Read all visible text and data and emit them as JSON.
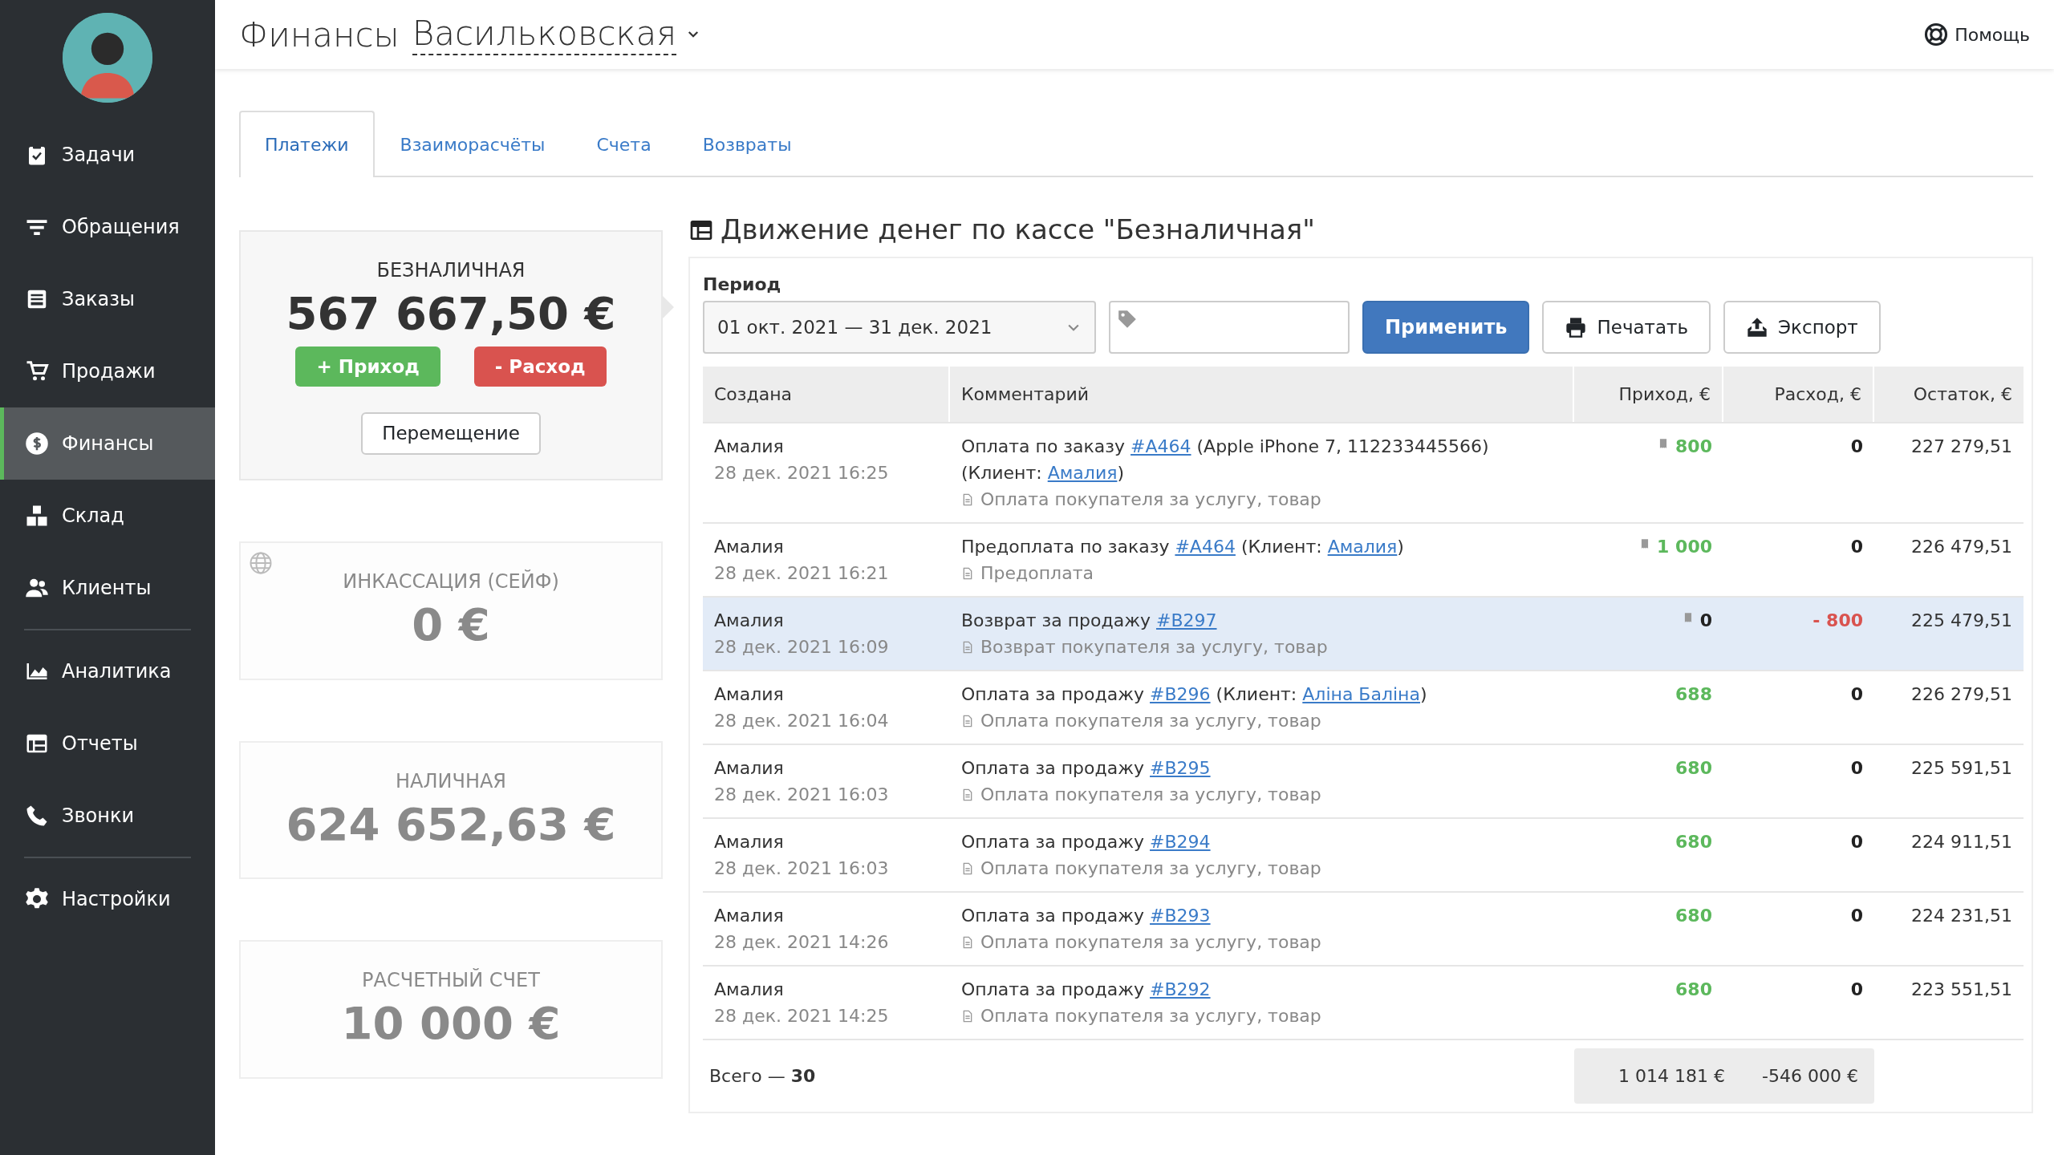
{
  "header": {
    "title": "Финансы",
    "store": "Васильковская",
    "help": "Помощь"
  },
  "sidebar": {
    "groups": [
      [
        {
          "label": "Задачи",
          "selected": false
        },
        {
          "label": "Обращения",
          "selected": false
        },
        {
          "label": "Заказы",
          "selected": false
        },
        {
          "label": "Продажи",
          "selected": false
        },
        {
          "label": "Финансы",
          "selected": true
        },
        {
          "label": "Склад",
          "selected": false
        },
        {
          "label": "Клиенты",
          "selected": false
        }
      ],
      [
        {
          "label": "Аналитика",
          "selected": false
        },
        {
          "label": "Отчеты",
          "selected": false
        },
        {
          "label": "Звонки",
          "selected": false
        }
      ],
      [
        {
          "label": "Настройки",
          "selected": false
        }
      ]
    ]
  },
  "tabs": [
    {
      "label": "Платежи",
      "selected": true
    },
    {
      "label": "Взаиморасчёты",
      "selected": false
    },
    {
      "label": "Счета",
      "selected": false
    },
    {
      "label": "Возвраты",
      "selected": false
    }
  ],
  "registers": [
    {
      "name": "БЕЗНАЛИЧНАЯ",
      "amount": "567 667,50 €",
      "selected": true,
      "kind": "plain",
      "buttons": [
        {
          "label": "+ Приход",
          "kind": "income"
        },
        {
          "label": "- Расход",
          "kind": "expense"
        },
        {
          "label": "Перемещение",
          "kind": "transfer"
        }
      ]
    },
    {
      "name": "ИНКАССАЦИЯ (СЕЙФ)",
      "amount": "0 €",
      "selected": false,
      "kind": "web"
    },
    {
      "name": "НАЛИЧНАЯ",
      "amount": "624 652,63 €",
      "selected": false,
      "kind": "plain"
    },
    {
      "name": "РАСЧЕТНЫЙ СЧЕТ",
      "amount": "10 000 €",
      "selected": false,
      "kind": "plain"
    }
  ],
  "movement": {
    "title": "Движение денег по кассе \"Безналичная\"",
    "period_label": "Период",
    "period": "01 окт. 2021 — 31 дек. 2021",
    "apply": "Применить",
    "print": "Печатать",
    "export": "Экспорт",
    "columns": [
      "Создана",
      "Комментарий",
      "Приход, €",
      "Расход, €",
      "Остаток, €"
    ],
    "rows": [
      {
        "author": "Амалия",
        "date": "28 дек. 2021 16:25",
        "comment": [
          {
            "kind": "text",
            "text": "Оплата по заказу "
          },
          {
            "kind": "link",
            "text": "#A464"
          },
          {
            "kind": "text",
            "text": " (Apple iPhone 7, 112233445566) (Клиент: "
          },
          {
            "kind": "link",
            "text": "Амалия"
          },
          {
            "kind": "text",
            "text": ")"
          }
        ],
        "note": "Оплата покупателя за услугу, товар",
        "receipt": true,
        "income": "800",
        "income_positive": true,
        "expense": "0",
        "expense_negative": false,
        "balance": "227 279,51",
        "selected": false
      },
      {
        "author": "Амалия",
        "date": "28 дек. 2021 16:21",
        "comment": [
          {
            "kind": "text",
            "text": "Предоплата по заказу "
          },
          {
            "kind": "link",
            "text": "#A464"
          },
          {
            "kind": "text",
            "text": " (Клиент: "
          },
          {
            "kind": "link",
            "text": "Амалия"
          },
          {
            "kind": "text",
            "text": ")"
          }
        ],
        "note": "Предоплата",
        "receipt": true,
        "income": "1 000",
        "income_positive": true,
        "expense": "0",
        "expense_negative": false,
        "balance": "226 479,51",
        "selected": false
      },
      {
        "author": "Амалия",
        "date": "28 дек. 2021 16:09",
        "comment": [
          {
            "kind": "text",
            "text": "Возврат за продажу "
          },
          {
            "kind": "link",
            "text": "#B297"
          }
        ],
        "note": "Возврат покупателя за услугу, товар",
        "receipt": true,
        "income": "0",
        "income_positive": false,
        "expense": "- 800",
        "expense_negative": true,
        "balance": "225 479,51",
        "selected": true
      },
      {
        "author": "Амалия",
        "date": "28 дек. 2021 16:04",
        "comment": [
          {
            "kind": "text",
            "text": "Оплата за продажу "
          },
          {
            "kind": "link",
            "text": "#B296"
          },
          {
            "kind": "text",
            "text": " (Клиент: "
          },
          {
            "kind": "link",
            "text": "Аліна Баліна"
          },
          {
            "kind": "text",
            "text": ")"
          }
        ],
        "note": "Оплата покупателя за услугу, товар",
        "receipt": false,
        "income": "688",
        "income_positive": true,
        "expense": "0",
        "expense_negative": false,
        "balance": "226 279,51",
        "selected": false
      },
      {
        "author": "Амалия",
        "date": "28 дек. 2021 16:03",
        "comment": [
          {
            "kind": "text",
            "text": "Оплата за продажу "
          },
          {
            "kind": "link",
            "text": "#B295"
          }
        ],
        "note": "Оплата покупателя за услугу, товар",
        "receipt": false,
        "income": "680",
        "income_positive": true,
        "expense": "0",
        "expense_negative": false,
        "balance": "225 591,51",
        "selected": false
      },
      {
        "author": "Амалия",
        "date": "28 дек. 2021 16:03",
        "comment": [
          {
            "kind": "text",
            "text": "Оплата за продажу "
          },
          {
            "kind": "link",
            "text": "#B294"
          }
        ],
        "note": "Оплата покупателя за услугу, товар",
        "receipt": false,
        "income": "680",
        "income_positive": true,
        "expense": "0",
        "expense_negative": false,
        "balance": "224 911,51",
        "selected": false
      },
      {
        "author": "Амалия",
        "date": "28 дек. 2021 14:26",
        "comment": [
          {
            "kind": "text",
            "text": "Оплата за продажу "
          },
          {
            "kind": "link",
            "text": "#B293"
          }
        ],
        "note": "Оплата покупателя за услугу, товар",
        "receipt": false,
        "income": "680",
        "income_positive": true,
        "expense": "0",
        "expense_negative": false,
        "balance": "224 231,51",
        "selected": false
      },
      {
        "author": "Амалия",
        "date": "28 дек. 2021 14:25",
        "comment": [
          {
            "kind": "text",
            "text": "Оплата за продажу "
          },
          {
            "kind": "link",
            "text": "#B292"
          }
        ],
        "note": "Оплата покупателя за услугу, товар",
        "receipt": false,
        "income": "680",
        "income_positive": true,
        "expense": "0",
        "expense_negative": false,
        "balance": "223 551,51",
        "selected": false
      }
    ],
    "total": "Всего — **30**",
    "total_income": "1 014 181 €",
    "total_expense": "-546 000 €"
  }
}
